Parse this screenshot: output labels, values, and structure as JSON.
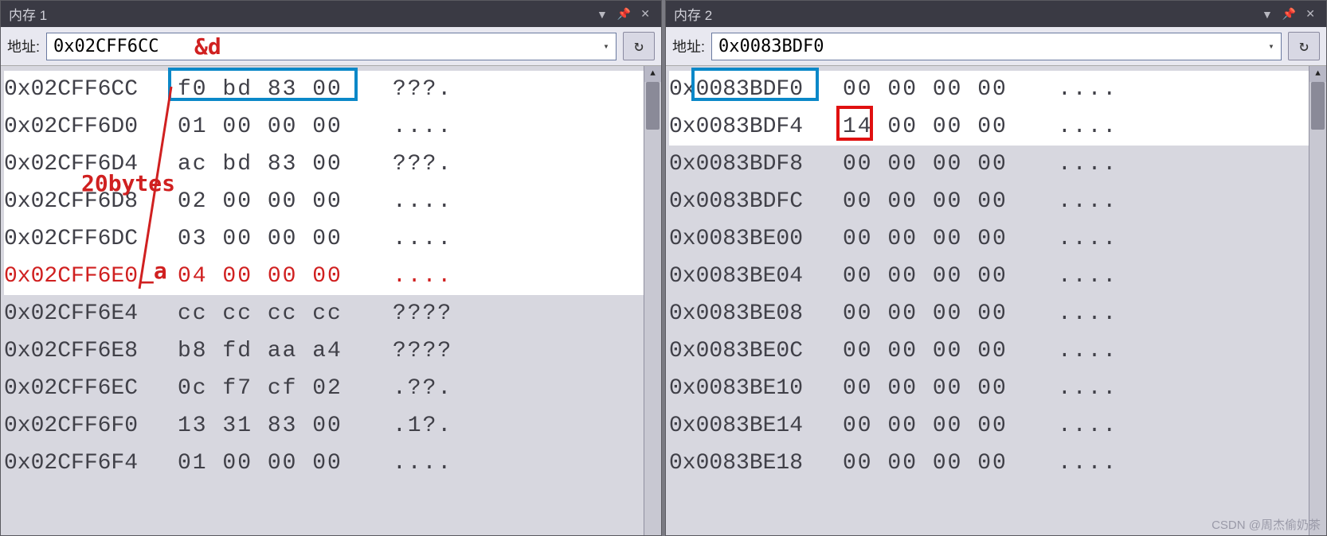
{
  "panels": [
    {
      "title": "内存 1",
      "addr_label": "地址:",
      "addr_value": "0x02CFF6CC",
      "rows": [
        {
          "addr": "0x02CFF6CC",
          "hex": "f0 bd 83 00",
          "ascii": "???.",
          "hl": true
        },
        {
          "addr": "0x02CFF6D0",
          "hex": "01 00 00 00",
          "ascii": "....",
          "hl": true
        },
        {
          "addr": "0x02CFF6D4",
          "hex": "ac bd 83 00",
          "ascii": "???.",
          "hl": true
        },
        {
          "addr": "0x02CFF6D8",
          "hex": "02 00 00 00",
          "ascii": "....",
          "hl": true
        },
        {
          "addr": "0x02CFF6DC",
          "hex": "03 00 00 00",
          "ascii": "....",
          "hl": true
        },
        {
          "addr": "0x02CFF6E0",
          "hex": "04 00 00 00",
          "ascii": "....",
          "hl": true,
          "red": true
        },
        {
          "addr": "0x02CFF6E4",
          "hex": "cc cc cc cc",
          "ascii": "????"
        },
        {
          "addr": "0x02CFF6E8",
          "hex": "b8 fd aa a4",
          "ascii": "????"
        },
        {
          "addr": "0x02CFF6EC",
          "hex": "0c f7 cf 02",
          "ascii": ".??."
        },
        {
          "addr": "0x02CFF6F0",
          "hex": "13 31 83 00",
          "ascii": ".1?."
        },
        {
          "addr": "0x02CFF6F4",
          "hex": "01 00 00 00",
          "ascii": "...."
        }
      ]
    },
    {
      "title": "内存 2",
      "addr_label": "地址:",
      "addr_value": "0x0083BDF0",
      "rows": [
        {
          "addr": "0x0083BDF0",
          "hex": "00 00 00 00",
          "ascii": "....",
          "hl": true
        },
        {
          "addr": "0x0083BDF4",
          "hex": "14 00 00 00",
          "ascii": "....",
          "hl": true
        },
        {
          "addr": "0x0083BDF8",
          "hex": "00 00 00 00",
          "ascii": "...."
        },
        {
          "addr": "0x0083BDFC",
          "hex": "00 00 00 00",
          "ascii": "...."
        },
        {
          "addr": "0x0083BE00",
          "hex": "00 00 00 00",
          "ascii": "...."
        },
        {
          "addr": "0x0083BE04",
          "hex": "00 00 00 00",
          "ascii": "...."
        },
        {
          "addr": "0x0083BE08",
          "hex": "00 00 00 00",
          "ascii": "...."
        },
        {
          "addr": "0x0083BE0C",
          "hex": "00 00 00 00",
          "ascii": "...."
        },
        {
          "addr": "0x0083BE10",
          "hex": "00 00 00 00",
          "ascii": "...."
        },
        {
          "addr": "0x0083BE14",
          "hex": "00 00 00 00",
          "ascii": "...."
        },
        {
          "addr": "0x0083BE18",
          "hex": "00 00 00 00",
          "ascii": "...."
        }
      ]
    }
  ],
  "annotations": {
    "amp_d": "&d",
    "twenty_bytes": "20bytes",
    "underscore_a": "_a"
  },
  "watermark": "CSDN @周杰偷奶茶"
}
